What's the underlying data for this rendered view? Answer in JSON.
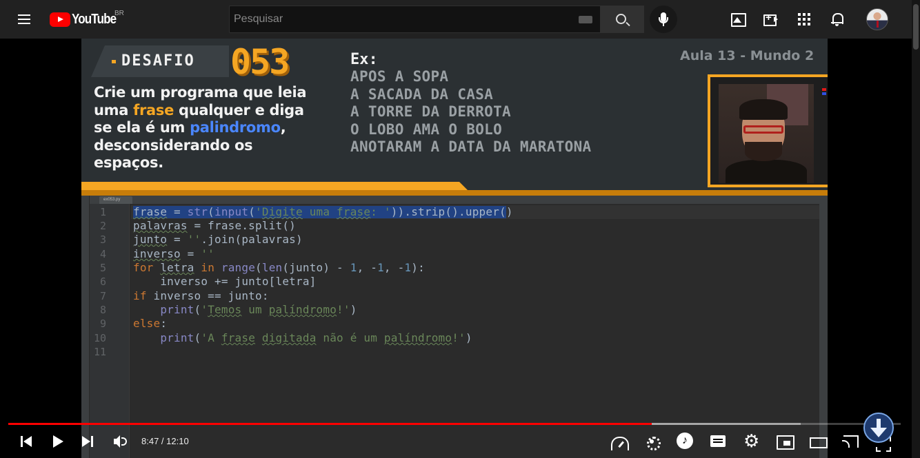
{
  "header": {
    "logo_text": "YouTube",
    "region": "BR",
    "search": {
      "placeholder": "Pesquisar",
      "value": ""
    }
  },
  "video": {
    "banner": {
      "desafio_label": "DESAFIO",
      "desafio_number": "053",
      "description": {
        "l1": "Crie um programa que leia",
        "l2_a": "uma ",
        "l2_hl": "frase",
        "l2_b": " qualquer e diga",
        "l3_a": "se ela é um ",
        "l3_hl": "palindromo",
        "l3_b": ",",
        "l4": "desconsiderando os",
        "l5": "espaços."
      },
      "example_title": "Ex:",
      "examples": [
        "APOS A SOPA",
        "A SACADA DA CASA",
        "A TORRE DA DERROTA",
        "O LOBO AMA O BOLO",
        "ANOTARAM A DATA DA MARATONA"
      ],
      "lesson": "Aula 13 - Mundo 2"
    },
    "ide": {
      "filename": "ex053.py",
      "line_numbers": [
        "1",
        "2",
        "3",
        "4",
        "5",
        "6",
        "7",
        "8",
        "9",
        "10",
        "11"
      ]
    }
  },
  "player": {
    "current_time": "8:47",
    "duration": "12:10",
    "time_display": "8:47 / 12:10",
    "progress_fraction": 0.72
  },
  "colors": {
    "accent_red": "#ff0000",
    "challenge_orange": "#f5a623",
    "highlight_blue": "#4a86ff",
    "selection_blue": "#214283"
  }
}
